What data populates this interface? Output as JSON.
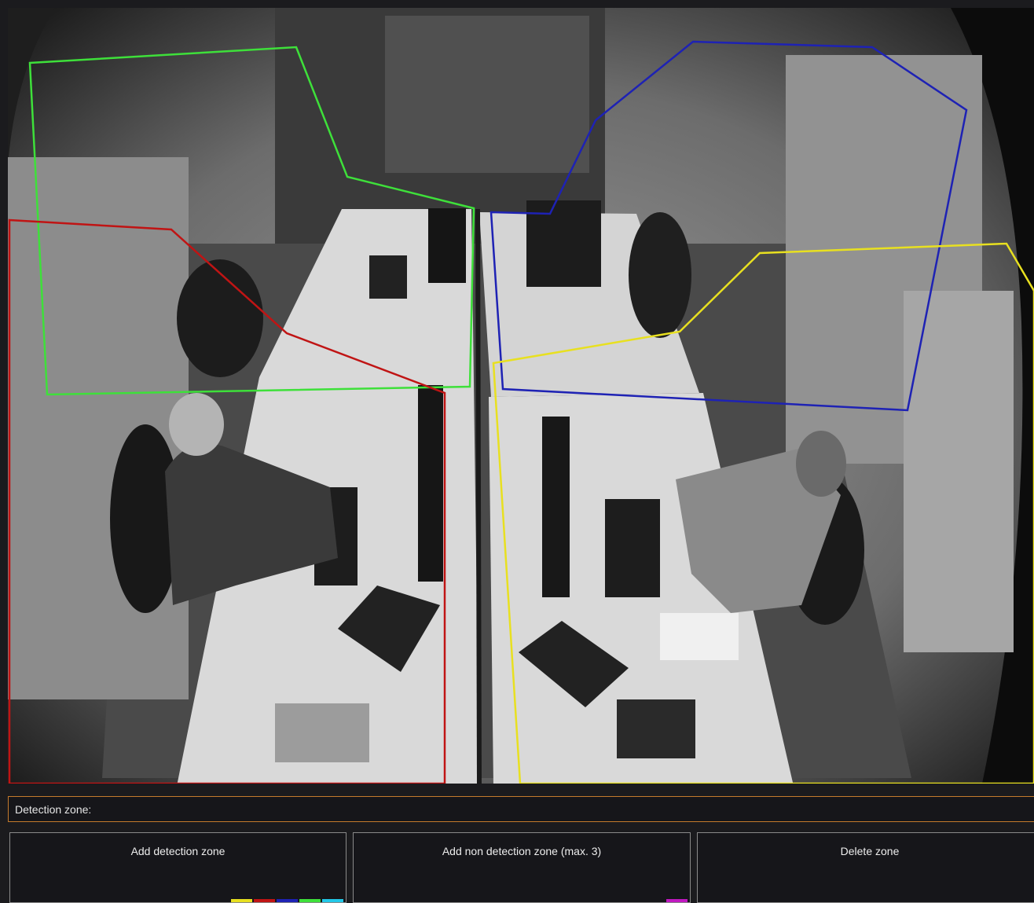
{
  "zone_label": "Detection zone:",
  "buttons": {
    "add_detection": "Add detection zone",
    "add_non_detection": "Add non detection zone (max. 3)",
    "delete": "Delete zone"
  },
  "zones": [
    {
      "name": "green-zone",
      "color": "#3ee03a"
    },
    {
      "name": "red-zone",
      "color": "#c01414"
    },
    {
      "name": "blue-zone",
      "color": "#1e22b4"
    },
    {
      "name": "yellow-zone",
      "color": "#e8e020"
    }
  ],
  "detection_zone_colors": [
    "#e8e020",
    "#c01414",
    "#1e22b4",
    "#3ee03a",
    "#22c8e8"
  ],
  "non_detection_zone_colors": [
    "#c018c0"
  ]
}
